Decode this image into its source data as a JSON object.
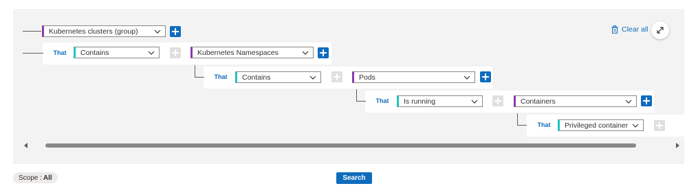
{
  "query_builder": {
    "clear_all_label": "Clear all",
    "rows": [
      {
        "entity": "Kubernetes clusters (group)"
      },
      {
        "connector": "That",
        "condition": "Contains",
        "entity": "Kubernetes Namespaces"
      },
      {
        "connector": "That",
        "condition": "Contains",
        "entity": "Pods"
      },
      {
        "connector": "That",
        "condition": "Is running",
        "entity": "Containers"
      },
      {
        "connector": "That",
        "condition": "Privileged container"
      }
    ]
  },
  "footer": {
    "scope_label": "Scope :",
    "scope_value": "All",
    "search_label": "Search"
  },
  "colors": {
    "accent": "#0f6cbd",
    "entity_marker": "#8a3ab0",
    "condition_marker": "#22c2c2",
    "canvas_bg": "#f3f3f3"
  }
}
